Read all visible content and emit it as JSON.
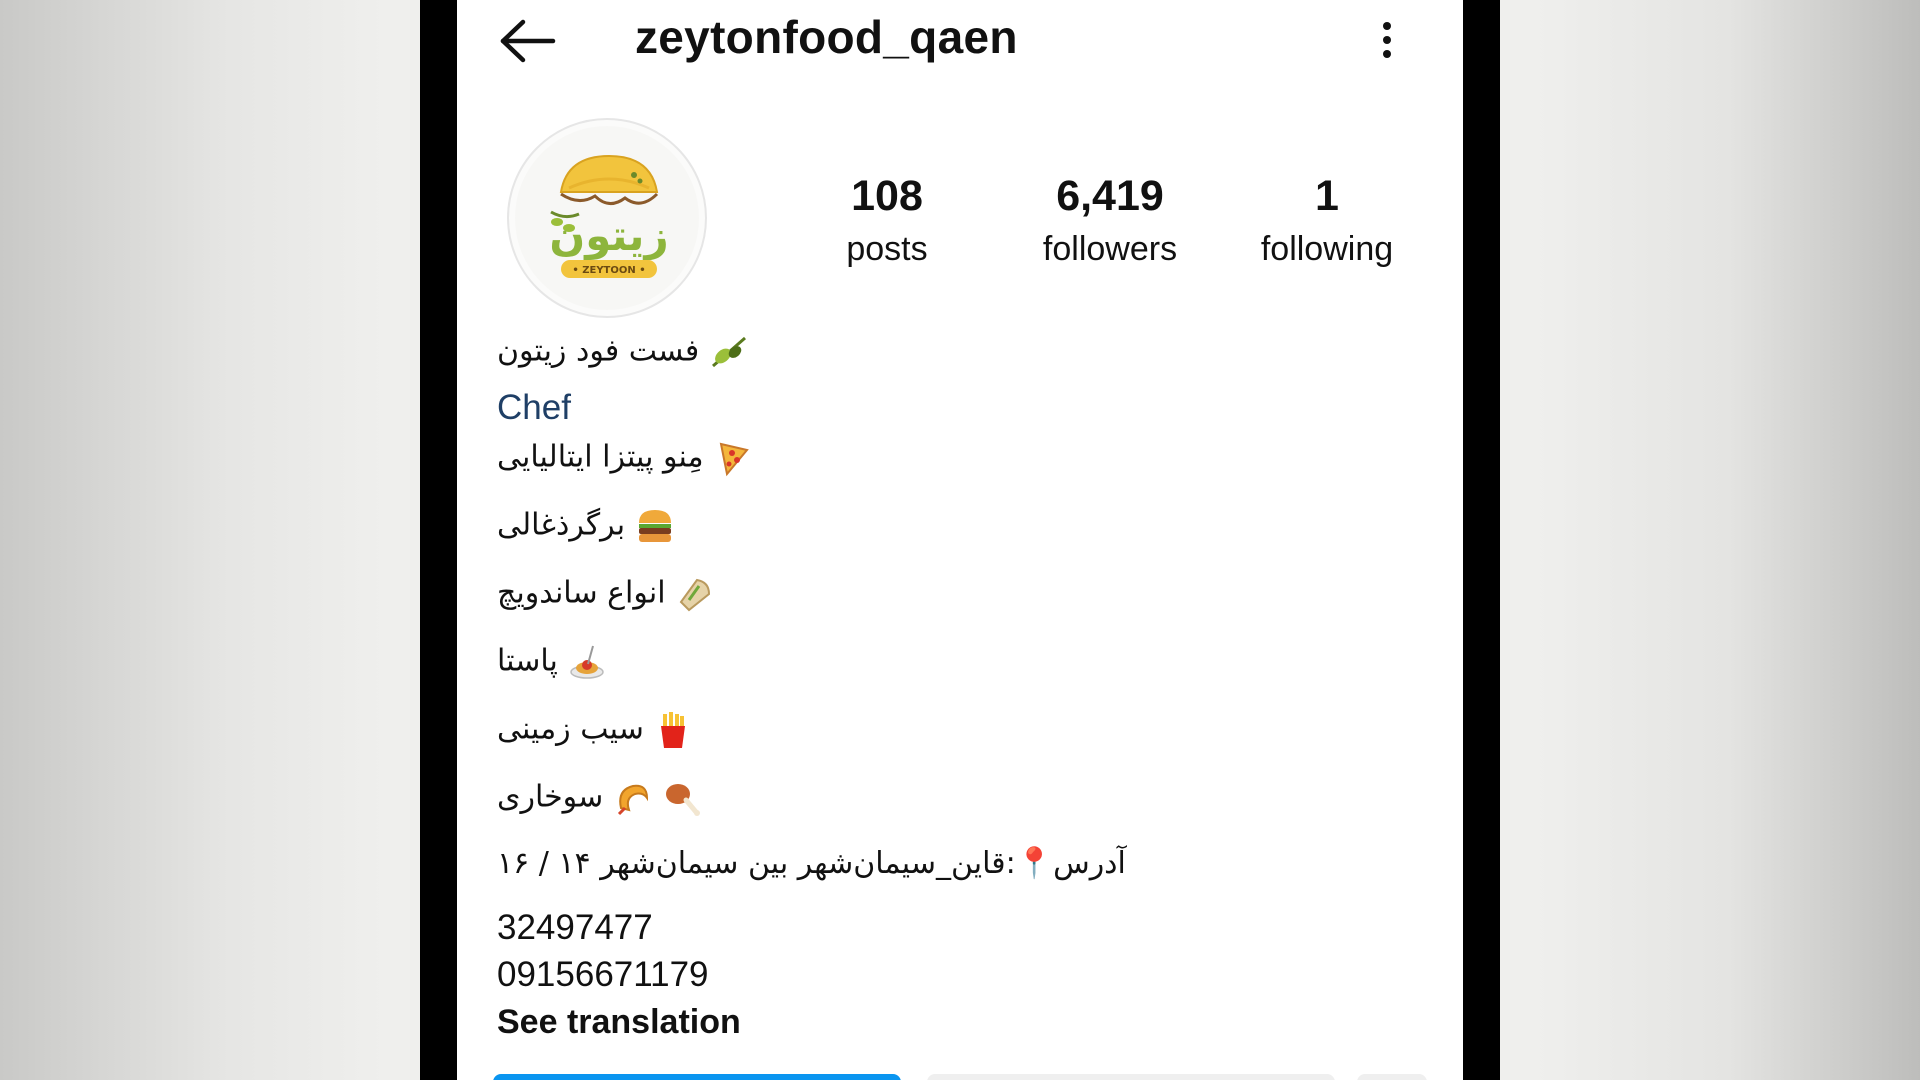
{
  "header": {
    "username": "zeytonfood_qaen",
    "back_icon": "arrow-left-icon",
    "more_icon": "more-vertical-icon"
  },
  "profile": {
    "avatar_logo_text_fa": "زیتون",
    "avatar_logo_text_en": "ZEYTOON",
    "stats": {
      "posts": {
        "value": "108",
        "label": "posts"
      },
      "followers": {
        "value": "6,419",
        "label": "followers"
      },
      "following": {
        "value": "1",
        "label": "following"
      }
    }
  },
  "bio": {
    "name": "فست فود زیتون",
    "category": "Chef",
    "lines": [
      {
        "text": "مِنو پیتزا ایتالیایی",
        "icon": "pizza-icon"
      },
      {
        "text": "برگرذغالی",
        "icon": "burger-icon"
      },
      {
        "text": "انواع ساندویچ",
        "icon": "sandwich-icon"
      },
      {
        "text": "پاستا",
        "icon": "pasta-icon"
      },
      {
        "text": "سیب زمینی",
        "icon": "fries-icon"
      },
      {
        "text": "سوخاری",
        "icon": "fried-chicken-icon"
      }
    ],
    "address": "آدرس📍:قاین_سیمان‌شهر بین سیمان‌شهر ۱۴ / ۱۶",
    "phone1": "32497477",
    "phone2": "09156671179",
    "see_translation": "See translation"
  },
  "colors": {
    "category_link": "#1f3f66",
    "follow_button": "#0a95f0",
    "secondary_button": "#efefef"
  }
}
